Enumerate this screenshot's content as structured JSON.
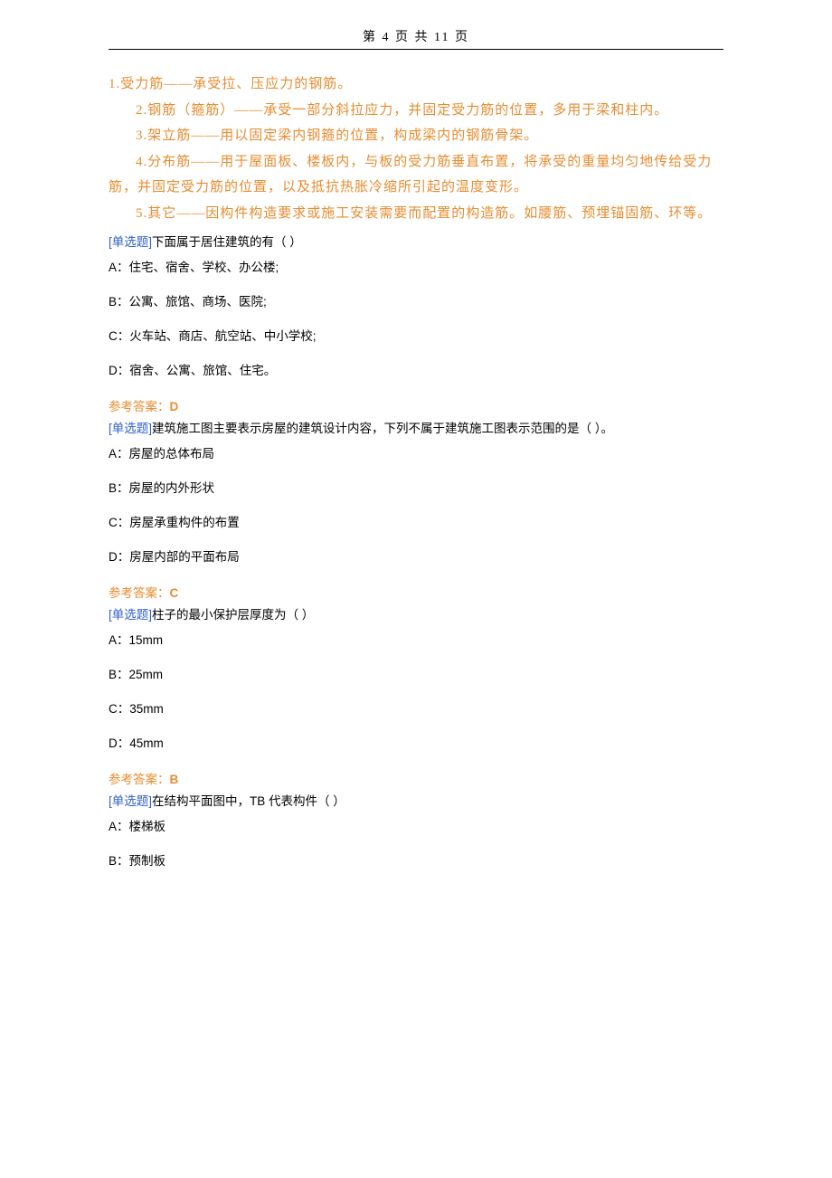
{
  "header": "第 4 页 共 11 页",
  "explain": {
    "l1": "1.受力筋——承受拉、压应力的钢筋。",
    "l2": "2.钢筋（箍筋）——承受一部分斜拉应力，并固定受力筋的位置，多用于梁和柱内。",
    "l3": "3.架立筋——用以固定梁内钢箍的位置，构成梁内的钢筋骨架。",
    "l4": "4.分布筋——用于屋面板、楼板内，与板的受力筋垂直布置，将承受的重量均匀地传给受力筋，并固定受力筋的位置，以及抵抗热胀冷缩所引起的温度变形。",
    "l5": "5.其它——因构件构造要求或施工安装需要而配置的构造筋。如腰筋、预埋锚固筋、环等。"
  },
  "q1": {
    "tag": "[单选题]",
    "text": "下面属于居住建筑的有（ ）",
    "opts": {
      "a": "A：住宅、宿舍、学校、办公楼;",
      "b": "B：公寓、旅馆、商场、医院;",
      "c": "C：火车站、商店、航空站、中小学校;",
      "d": "D：宿舍、公寓、旅馆、住宅。"
    },
    "answer_label": "参考答案：",
    "answer": "D"
  },
  "q2": {
    "tag": "[单选题]",
    "text": "建筑施工图主要表示房屋的建筑设计内容，下列不属于建筑施工图表示范围的是（ ）。",
    "opts": {
      "a": "A：房屋的总体布局",
      "b": "B：房屋的内外形状",
      "c": "C：房屋承重构件的布置",
      "d": "D：房屋内部的平面布局"
    },
    "answer_label": "参考答案：",
    "answer": "C"
  },
  "q3": {
    "tag": "[单选题]",
    "text": "柱子的最小保护层厚度为（ ）",
    "opts": {
      "a": "A：15mm",
      "b": "B：25mm",
      "c": "C：35mm",
      "d": "D：45mm"
    },
    "answer_label": "参考答案：",
    "answer": "B"
  },
  "q4": {
    "tag": "[单选题]",
    "text": "在结构平面图中，TB 代表构件（ ）",
    "opts": {
      "a": "A：楼梯板",
      "b": "B：预制板"
    }
  }
}
